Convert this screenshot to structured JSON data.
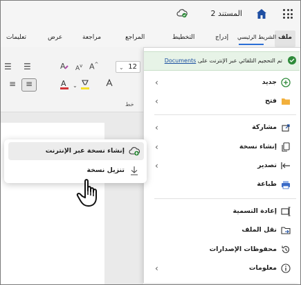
{
  "titlebar": {
    "doc_title": "المستند 2"
  },
  "tabs": [
    {
      "id": "file",
      "label": "ملف"
    },
    {
      "id": "home",
      "label": "الشريط الرئيسي"
    },
    {
      "id": "insert",
      "label": "إدراج"
    },
    {
      "id": "layout",
      "label": "التخطيط"
    },
    {
      "id": "references",
      "label": "المراجع"
    },
    {
      "id": "review",
      "label": "مراجعة"
    },
    {
      "id": "view",
      "label": "عرض"
    },
    {
      "id": "help",
      "label": "تعليمات"
    }
  ],
  "ribbon": {
    "font_size": "12",
    "font_group_label": "خط"
  },
  "banner": {
    "text": "تم التحجيم التلقائي عبر الإنترنت على",
    "link": "Documents"
  },
  "menu": {
    "items": [
      {
        "label": "جديد",
        "icon": "plus-circle-icon",
        "has_submenu": true
      },
      {
        "label": "فتح",
        "icon": "folder-icon",
        "has_submenu": true
      },
      {
        "label": "مشاركة",
        "icon": "share-icon",
        "has_submenu": true
      },
      {
        "label": "إنشاء نسخة",
        "icon": "copy-icon",
        "has_submenu": true
      },
      {
        "label": "تصدير",
        "icon": "export-icon",
        "has_submenu": true
      },
      {
        "label": "طباعة",
        "icon": "printer-icon",
        "has_submenu": false
      },
      {
        "label": "إعادة التسمية",
        "icon": "rename-icon",
        "has_submenu": false
      },
      {
        "label": "نقل الملف",
        "icon": "move-folder-icon",
        "has_submenu": false
      },
      {
        "label": "محفوظات الإصدارات",
        "icon": "history-icon",
        "has_submenu": false
      },
      {
        "label": "معلومات",
        "icon": "info-icon",
        "has_submenu": true
      }
    ]
  },
  "flyout": {
    "items": [
      {
        "label": "إنشاء نسخة عبر الإنترنت",
        "icon": "cloud-add-icon"
      },
      {
        "label": "تنزيل نسخة",
        "icon": "download-icon"
      }
    ]
  },
  "colors": {
    "accent": "#2b6fd6",
    "banner_bg": "#e7f3e7",
    "font_red": "#d13438",
    "highlight_yellow": "#f7e12a"
  }
}
